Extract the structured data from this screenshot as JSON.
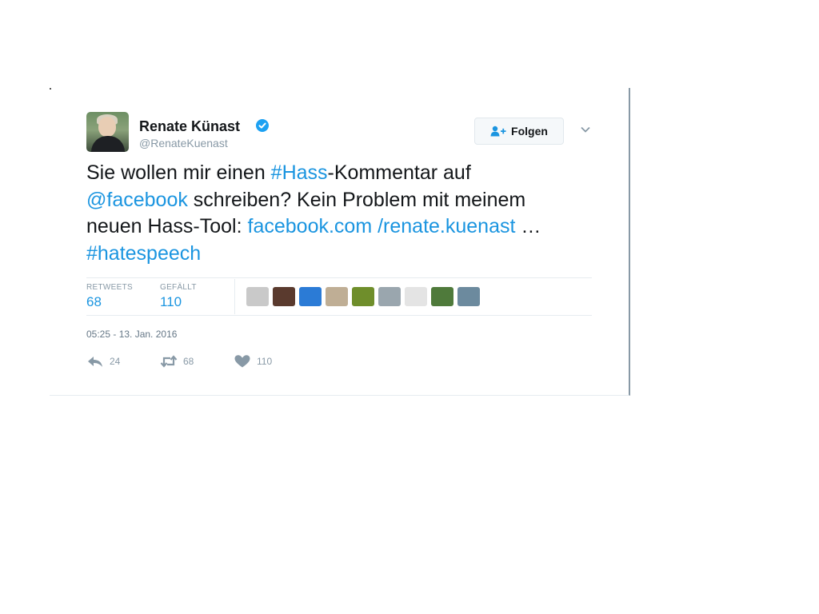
{
  "tweet": {
    "author": {
      "name": "Renate Künast",
      "handle": "@RenateKuenast",
      "verified": true
    },
    "follow_label": "Folgen",
    "text_segments": [
      {
        "text": "Sie wollen mir einen ",
        "link": false
      },
      {
        "text": "#Hass",
        "link": true
      },
      {
        "text": "-Kommentar auf ",
        "link": false
      },
      {
        "text": "@facebook",
        "link": true
      },
      {
        "text": " schreiben? Kein Problem mit meinem neuen Hass-Tool: ",
        "link": false
      },
      {
        "text": "facebook.com /renate.kuenast",
        "link": true
      },
      {
        "text": "  … ",
        "link": false
      },
      {
        "text": "#hatespeech",
        "link": true
      }
    ],
    "stats": {
      "retweets_label": "RETWEETS",
      "retweets_value": "68",
      "likes_label": "GEFÄLLT",
      "likes_value": "110"
    },
    "liker_avatars": [
      "#c9c9c9",
      "#5a3a2e",
      "#2b7bd6",
      "#bfae95",
      "#6f8e2b",
      "#9aa6ae",
      "#e4e4e4",
      "#4f7a3b",
      "#6c8a9e"
    ],
    "timestamp": "05:25 - 13. Jan. 2016",
    "actions": {
      "reply_count": "24",
      "retweet_count": "68",
      "like_count": "110"
    },
    "colors": {
      "link": "#1b95e0",
      "muted": "#8899a6",
      "text": "#14171a"
    },
    "icons": {
      "verified": "verified-badge-icon",
      "follow": "add-user-icon",
      "menu": "chevron-down-icon",
      "reply": "reply-icon",
      "retweet": "retweet-icon",
      "like": "heart-icon"
    }
  }
}
